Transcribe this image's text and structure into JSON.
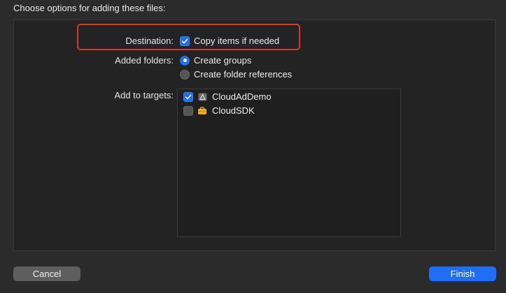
{
  "header": {
    "title": "Choose options for adding these files:"
  },
  "destination": {
    "label": "Destination:",
    "option_label": "Copy items if needed",
    "checked": true
  },
  "added_folders": {
    "label": "Added folders:",
    "options": [
      {
        "label": "Create groups",
        "selected": true
      },
      {
        "label": "Create folder references",
        "selected": false
      }
    ]
  },
  "targets": {
    "label": "Add to targets:",
    "items": [
      {
        "name": "CloudAdDemo",
        "checked": true,
        "icon": "app-target-icon"
      },
      {
        "name": "CloudSDK",
        "checked": false,
        "icon": "framework-target-icon"
      }
    ]
  },
  "buttons": {
    "cancel": "Cancel",
    "finish": "Finish"
  },
  "colors": {
    "accent": "#1f6ef5",
    "highlight": "#e0352b",
    "framework_icon": "#f2b400"
  }
}
